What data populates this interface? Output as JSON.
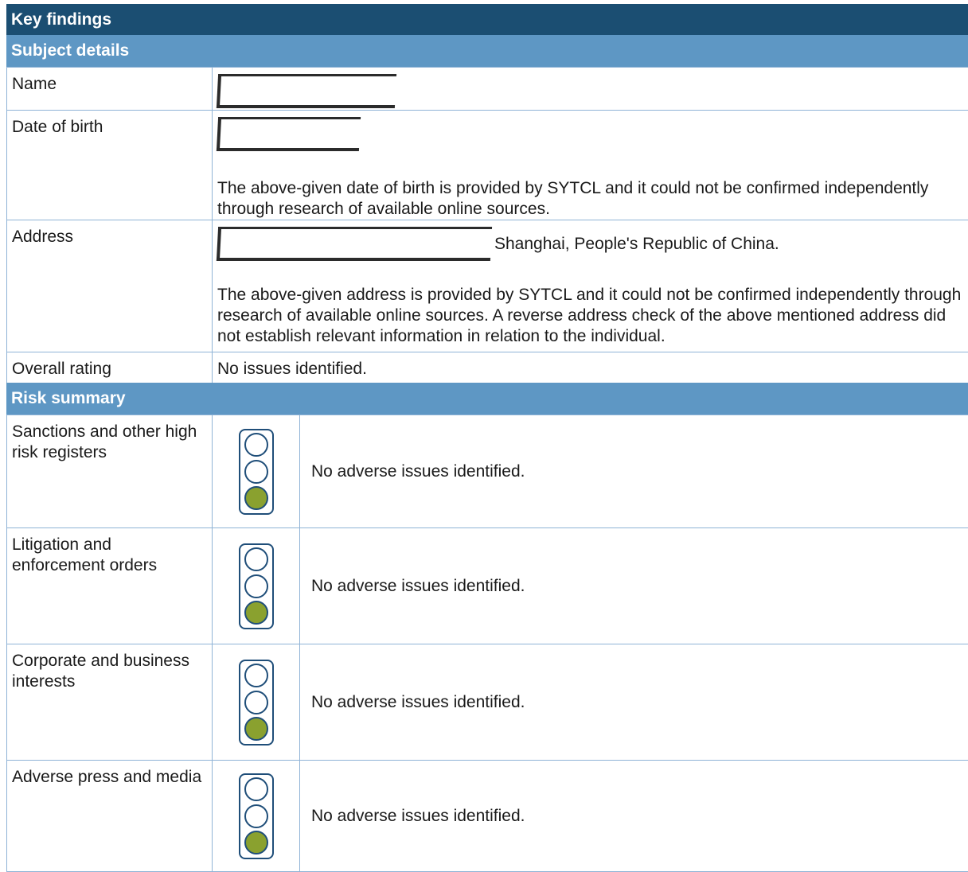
{
  "header": {
    "title": "Key findings"
  },
  "subject_details": {
    "heading": "Subject details",
    "rows": [
      {
        "label": "Name"
      },
      {
        "label": "Date of birth",
        "note": "The above-given date of birth is provided by SYTCL and it could not be confirmed independently through research of available online sources."
      },
      {
        "label": "Address",
        "value_suffix": "Shanghai, People's Republic of China.",
        "note": "The above-given address is provided by SYTCL and it could not be confirmed independently through research of available online sources. A reverse address check of the above mentioned address did not establish relevant information in relation to the individual."
      },
      {
        "label": "Overall rating",
        "value": "No issues identified."
      }
    ]
  },
  "risk_summary": {
    "heading": "Risk summary",
    "rows": [
      {
        "label": "Sanctions and other high risk registers",
        "status": "No adverse issues identified.",
        "light": "green"
      },
      {
        "label": "Litigation and enforcement orders",
        "status": "No adverse issues identified.",
        "light": "green"
      },
      {
        "label": "Corporate and business interests",
        "status": "No adverse issues identified.",
        "light": "green"
      },
      {
        "label": "Adverse press and media",
        "status": "No adverse issues identified.",
        "light": "green"
      }
    ]
  },
  "colors": {
    "title_bar": "#1b4e72",
    "section_bar": "#5e97c4",
    "border": "#8fb3d6",
    "green_light": "#8aa12f"
  }
}
